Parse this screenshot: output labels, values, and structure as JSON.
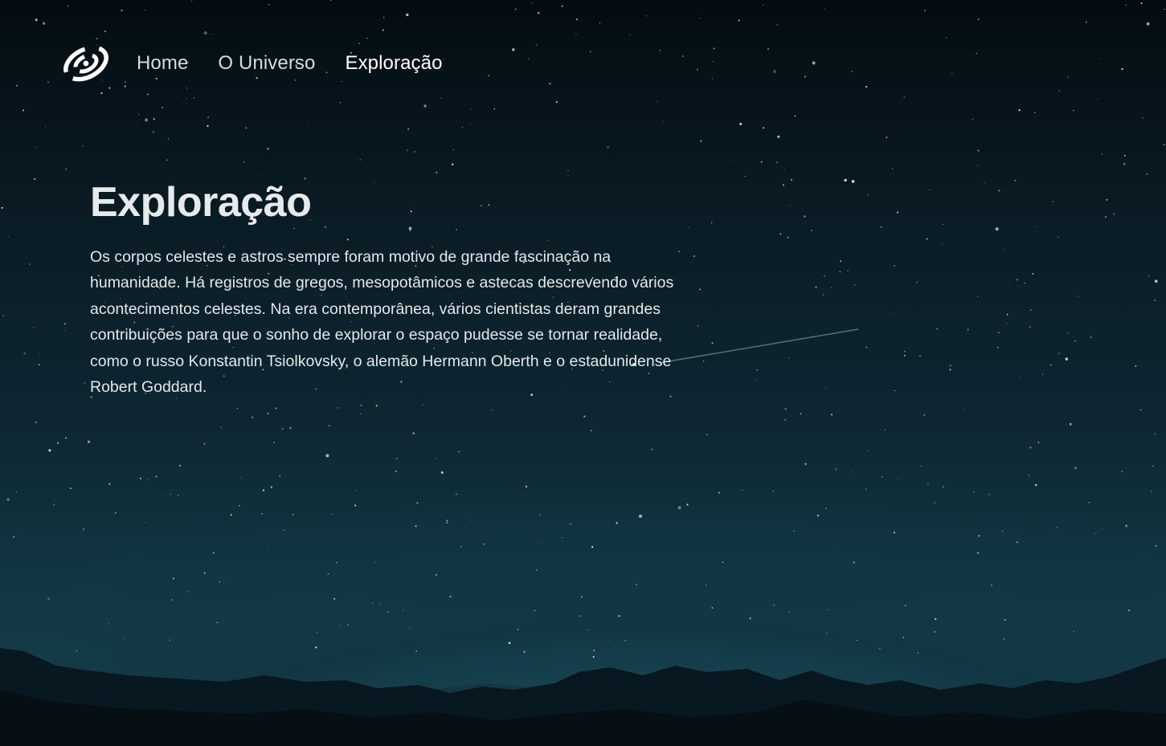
{
  "nav": {
    "logo_icon": "spiral-galaxy-icon",
    "links": [
      {
        "label": "Home",
        "active": false
      },
      {
        "label": "O Universo",
        "active": false
      },
      {
        "label": "Exploração",
        "active": true
      }
    ]
  },
  "hero": {
    "title": "Exploração",
    "text": "Os corpos celestes e astros sempre foram motivo de grande fascinação na humanidade. Há registros de gregos, mesopotâmicos e astecas descrevendo vários acontecimentos celestes. Na era contemporânea, vários cientistas deram grandes contribuições para que o sonho de explorar o espaço pudesse se tornar realidade, como o russo Konstantin Tsiolkovsky, o alemão Hermann Oberth e o estadunidense Robert Goddard."
  },
  "colors": {
    "sky_top": "#040c12",
    "sky_horizon": "#16404e",
    "text": "#e3e8ea",
    "mountains": "#071419"
  }
}
